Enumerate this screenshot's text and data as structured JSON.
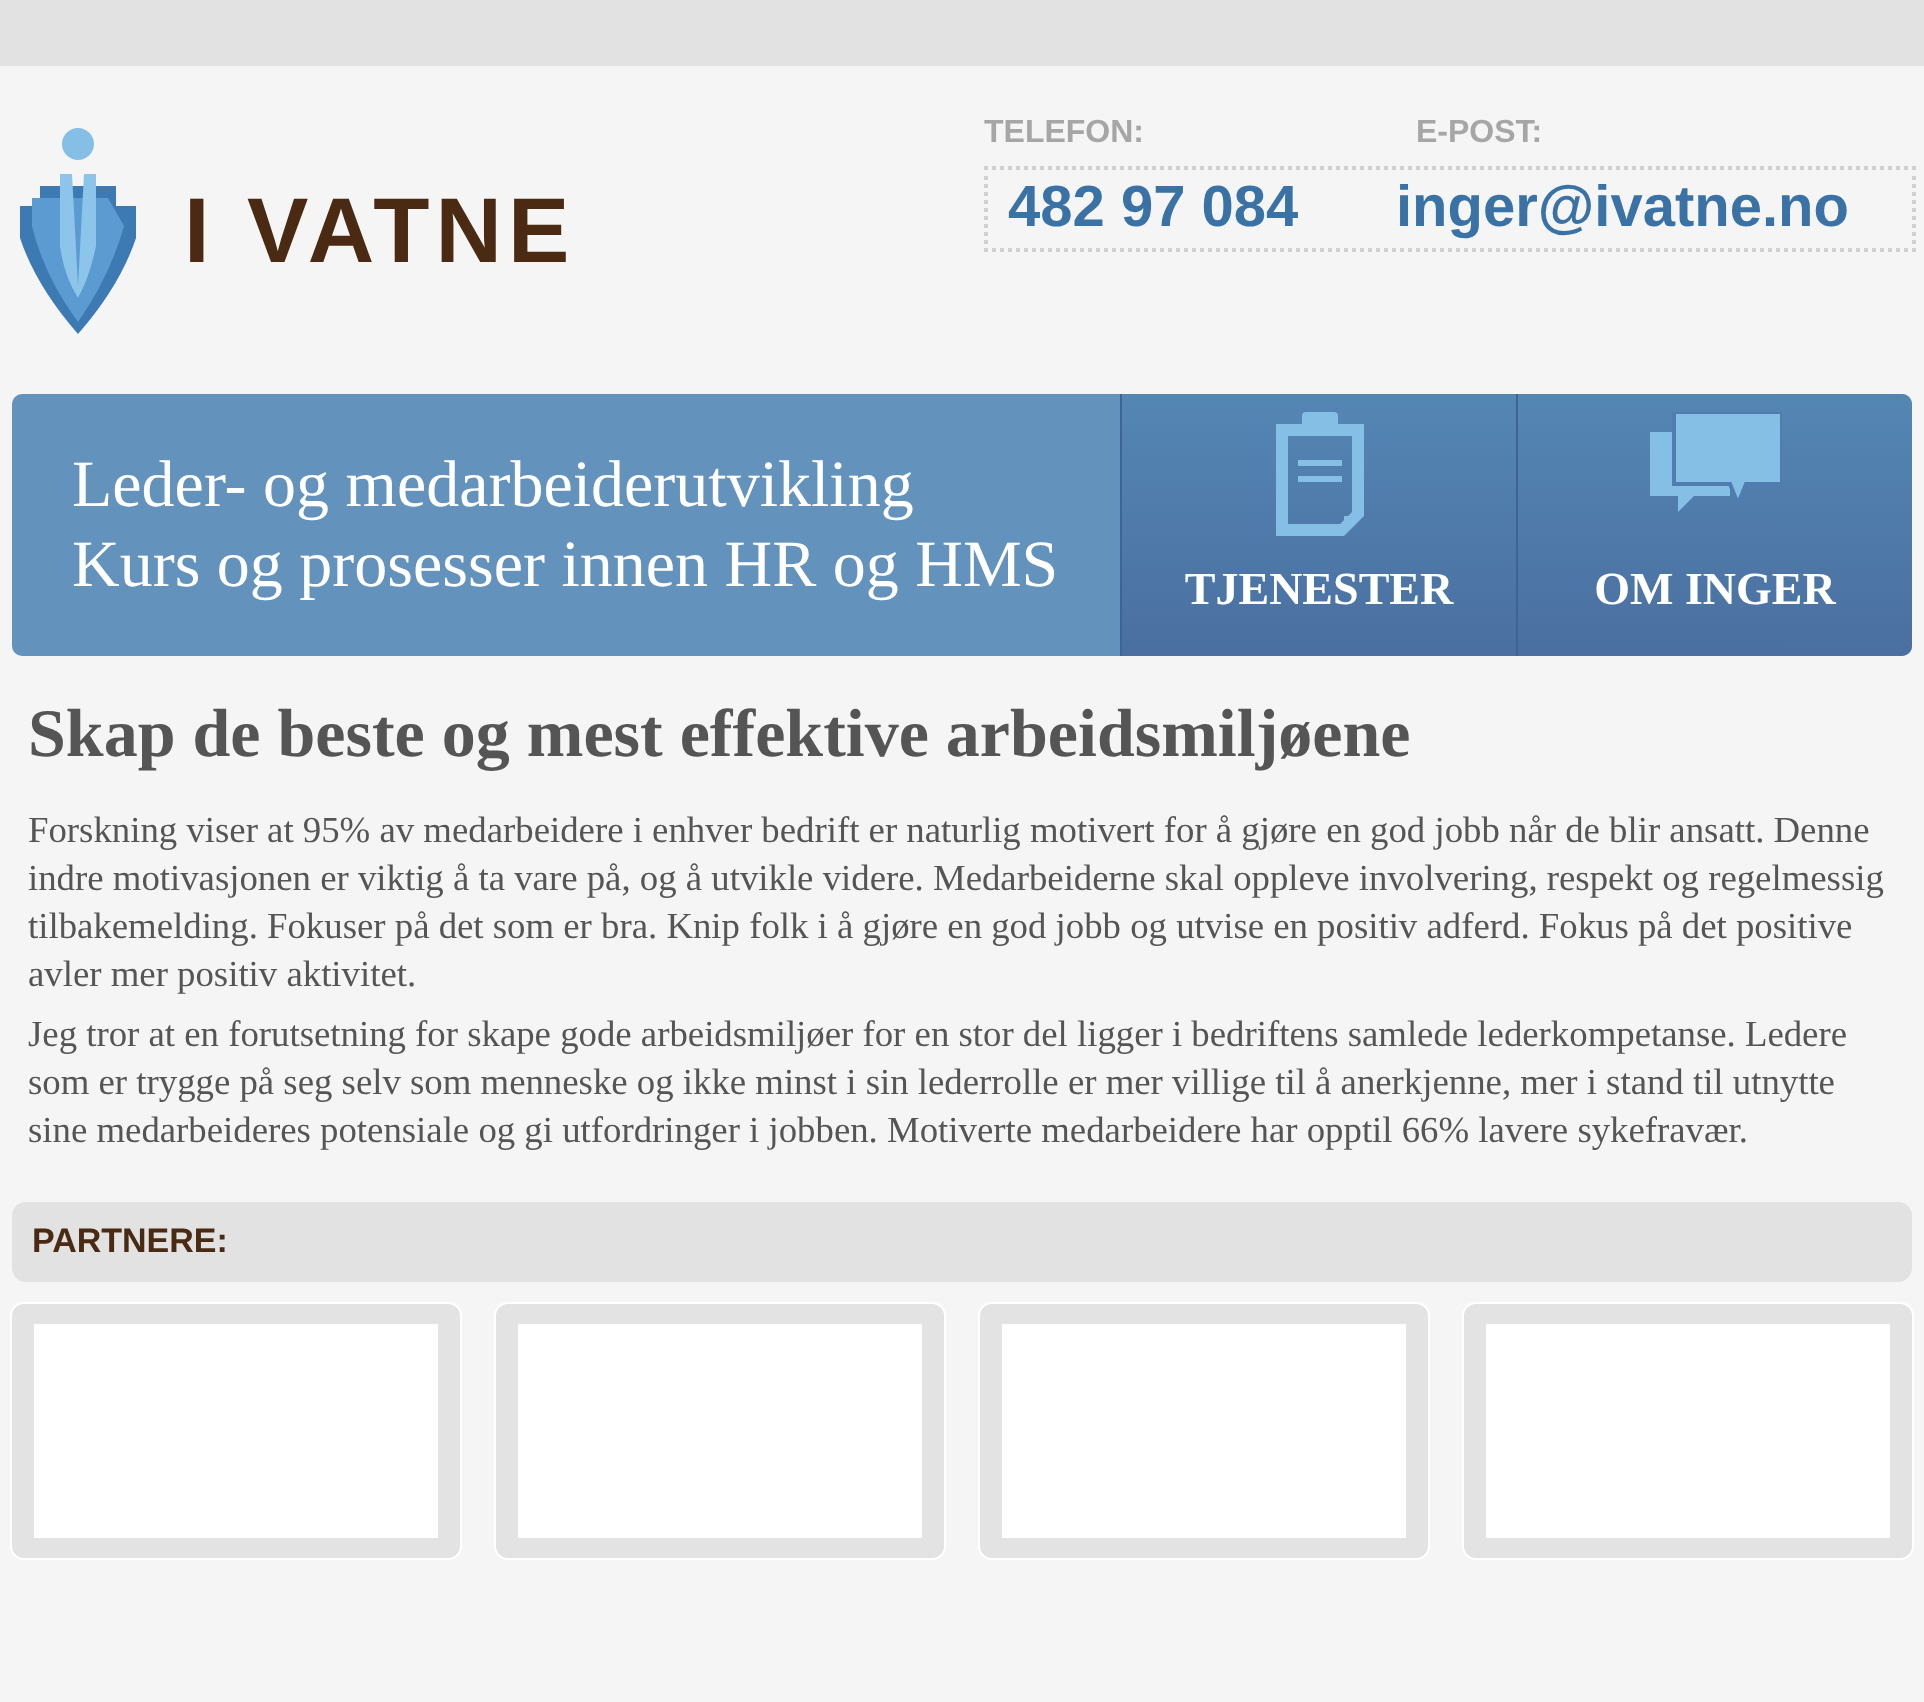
{
  "logo": {
    "text": "I VATNE"
  },
  "contact": {
    "phone_label": "TELEFON:",
    "phone": "482 97 084",
    "email_label": "E-POST:",
    "email": "inger@ivatne.no"
  },
  "banner": {
    "lines": [
      "Leder- og medarbeiderutvikling",
      "Kurs og prosesser innen HR og HMS"
    ],
    "tiles": [
      {
        "label": "TJENESTER",
        "kind": "clipboard"
      },
      {
        "label": "OM INGER",
        "kind": "chat"
      }
    ]
  },
  "article": {
    "heading": "Skap de beste og mest effektive arbeidsmiljøene",
    "paragraphs": [
      "Forskning viser at 95% av medarbeidere i enhver bedrift er naturlig motivert for å gjøre en god jobb når de blir ansatt. Denne indre motivasjonen er viktig å ta vare på, og å utvikle videre. Medarbeiderne skal oppleve involvering, respekt og regelmessig tilbakemelding. Fokuser på det som er bra. Knip folk i å gjøre en god jobb og utvise en positiv adferd. Fokus på det positive avler mer positiv aktivitet.",
      "Jeg tror at en forutsetning for skape gode arbeidsmiljøer for en stor del ligger i bedriftens samlede lederkompetanse. Ledere som er trygge på seg selv som menneske og ikke minst i sin lederrolle er mer villige til å anerkjenne, mer i stand til utnytte sine medarbeideres potensiale og gi utfordringer i jobben. Motiverte medarbeidere har opptil 66% lavere sykefravær."
    ]
  },
  "partners": {
    "title": "PARTNERE:",
    "logos": [
      {
        "kind": "blank"
      },
      {
        "kind": "blank"
      },
      {
        "kind": "blank"
      },
      {
        "kind": "blank"
      }
    ]
  }
}
